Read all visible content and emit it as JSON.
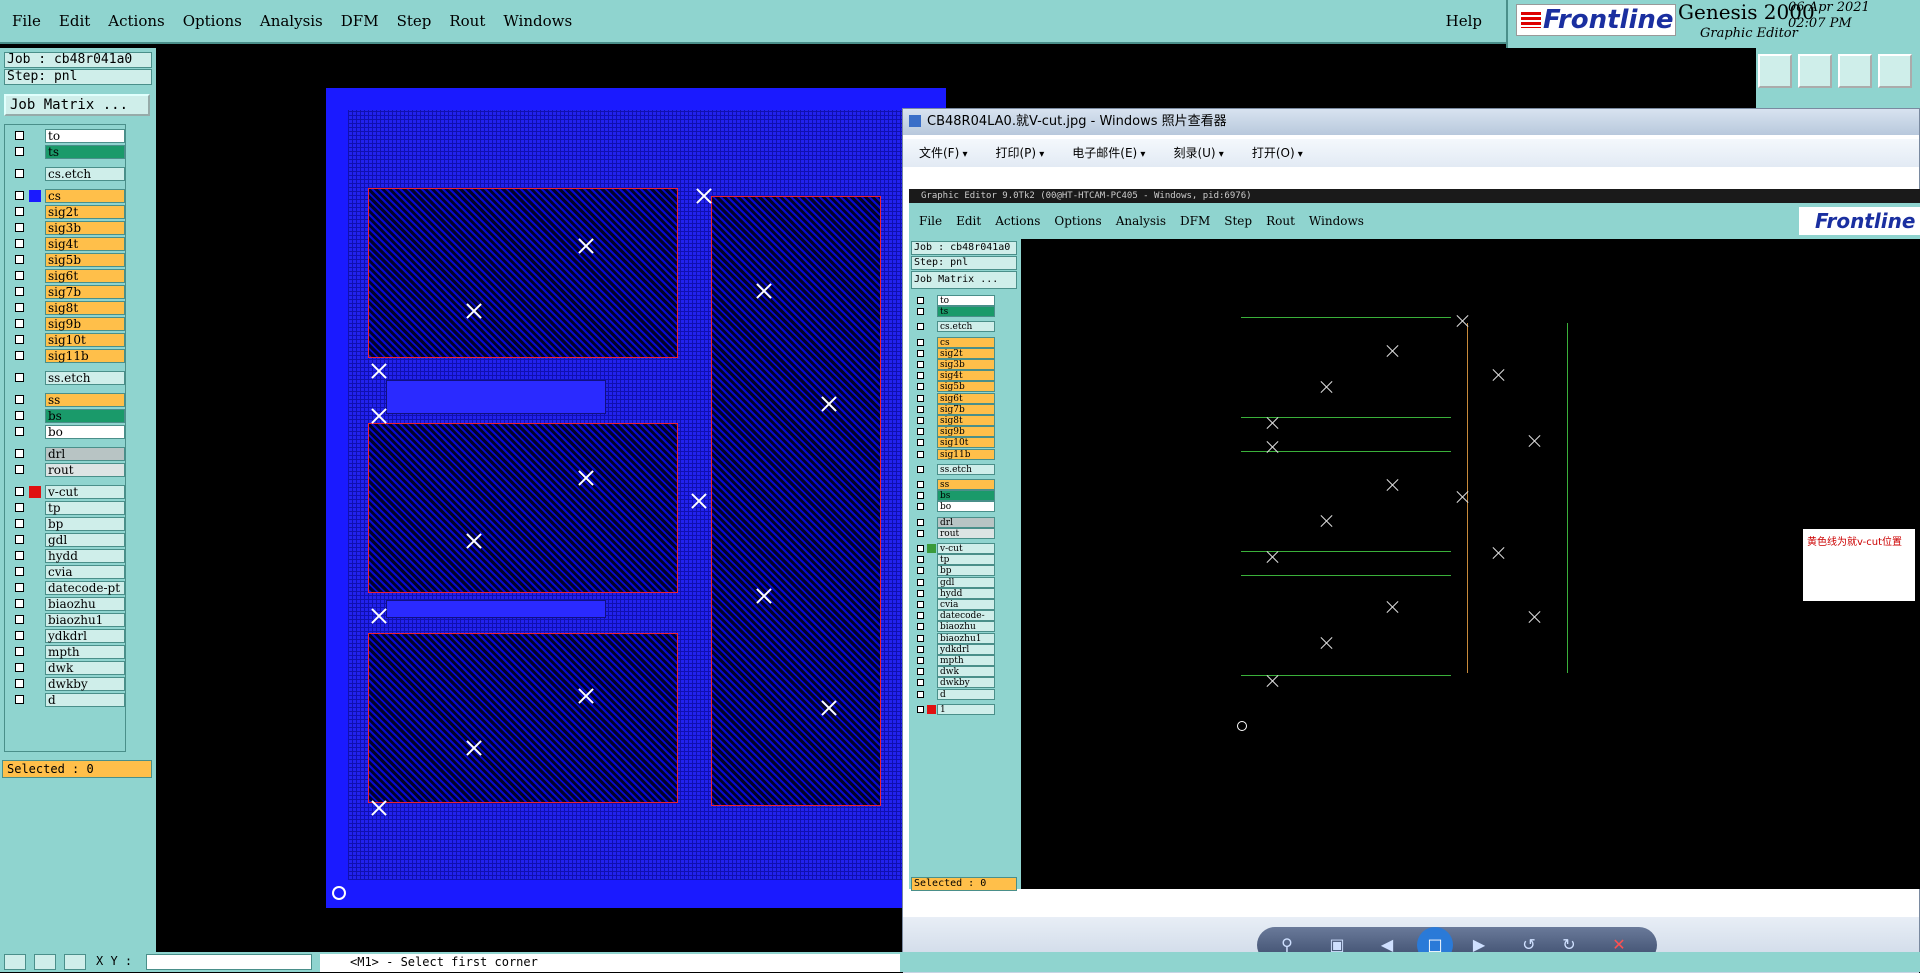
{
  "menu": {
    "items": [
      "File",
      "Edit",
      "Actions",
      "Options",
      "Analysis",
      "DFM",
      "Step",
      "Rout",
      "Windows"
    ],
    "help": "Help"
  },
  "brand": {
    "logo": "Frontline",
    "product": "Genesis 2000",
    "subtitle": "Graphic Editor",
    "date": "06 Apr 2021",
    "time": "02:07 PM"
  },
  "job": {
    "job_line": "Job : cb48r041a0",
    "step_line": "Step: pnl",
    "matrix_button": "Job Matrix ...",
    "selected": "Selected : 0"
  },
  "layers": [
    {
      "name": "to",
      "tone": "white",
      "color": ""
    },
    {
      "name": "ts",
      "tone": "green",
      "color": ""
    },
    {
      "name": "cs.etch",
      "tone": "cyan",
      "color": ""
    },
    {
      "name": "cs",
      "tone": "orange",
      "color": "#1a1aff"
    },
    {
      "name": "sig2t",
      "tone": "orange",
      "color": ""
    },
    {
      "name": "sig3b",
      "tone": "orange",
      "color": ""
    },
    {
      "name": "sig4t",
      "tone": "orange",
      "color": ""
    },
    {
      "name": "sig5b",
      "tone": "orange",
      "color": ""
    },
    {
      "name": "sig6t",
      "tone": "orange",
      "color": ""
    },
    {
      "name": "sig7b",
      "tone": "orange",
      "color": ""
    },
    {
      "name": "sig8t",
      "tone": "orange",
      "color": ""
    },
    {
      "name": "sig9b",
      "tone": "orange",
      "color": ""
    },
    {
      "name": "sig10t",
      "tone": "orange",
      "color": ""
    },
    {
      "name": "sig11b",
      "tone": "orange",
      "color": ""
    },
    {
      "name": "ss.etch",
      "tone": "cyan",
      "color": ""
    },
    {
      "name": "ss",
      "tone": "orange",
      "color": ""
    },
    {
      "name": "bs",
      "tone": "green",
      "color": ""
    },
    {
      "name": "bo",
      "tone": "white",
      "color": ""
    },
    {
      "name": "drl",
      "tone": "gray",
      "color": ""
    },
    {
      "name": "rout",
      "tone": "lgray",
      "color": ""
    },
    {
      "name": "v-cut",
      "tone": "cyan",
      "color": "#e01010"
    },
    {
      "name": "tp",
      "tone": "cyan",
      "color": ""
    },
    {
      "name": "bp",
      "tone": "cyan",
      "color": ""
    },
    {
      "name": "gdl",
      "tone": "cyan",
      "color": ""
    },
    {
      "name": "hydd",
      "tone": "cyan",
      "color": ""
    },
    {
      "name": "cvia",
      "tone": "cyan",
      "color": ""
    },
    {
      "name": "datecode-pt",
      "tone": "cyan",
      "color": ""
    },
    {
      "name": "biaozhu",
      "tone": "cyan",
      "color": ""
    },
    {
      "name": "biaozhu1",
      "tone": "cyan",
      "color": ""
    },
    {
      "name": "ydkdrl",
      "tone": "cyan",
      "color": ""
    },
    {
      "name": "mpth",
      "tone": "cyan",
      "color": ""
    },
    {
      "name": "dwk",
      "tone": "cyan",
      "color": ""
    },
    {
      "name": "dwkby",
      "tone": "cyan",
      "color": ""
    },
    {
      "name": "d",
      "tone": "cyan",
      "color": ""
    }
  ],
  "viewer": {
    "title": "CB48R04LA0.就V-cut.jpg - Windows 照片查看器",
    "menu": [
      "文件(F)",
      "打印(P)",
      "电子邮件(E)",
      "刻录(U)",
      "打开(O)"
    ],
    "inner_title": "Graphic Editor 9.0Tk2 (00@HT-HTCAM-PC405 - Windows, pid:6976)",
    "inner_job": "Job : cb48r041a0",
    "inner_step": "Step: pnl",
    "inner_matrix": "Job Matrix ...",
    "inner_selected": "Selected : 0",
    "inner_extra_layer": "1",
    "note": "黄色线为就v-cut位置"
  },
  "status": {
    "xy_label": "X Y :",
    "message": "<M1> - Select first corner"
  },
  "colors": {
    "chrome": "#8fd4cf",
    "board": "#1a1aff",
    "orange_layer": "#ffbf4a"
  }
}
